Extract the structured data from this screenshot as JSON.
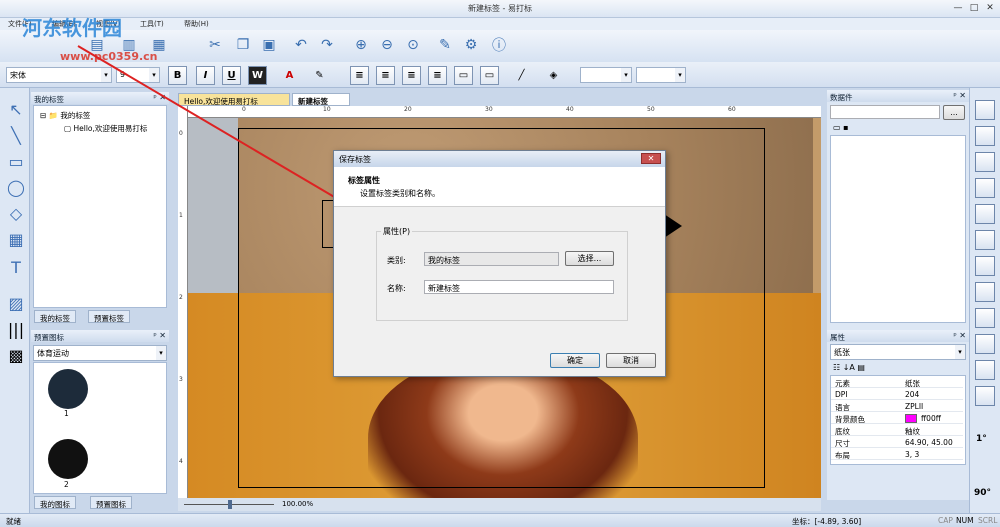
{
  "window": {
    "title": "新建标签 - 易打标",
    "min": "—",
    "max": "□",
    "close": "✕"
  },
  "menu": [
    "文件(F)",
    "编辑(E)",
    "视图(V)",
    "工具(T)",
    "帮助(H)"
  ],
  "font": {
    "family": "宋体",
    "size": "9"
  },
  "format_buttons": [
    "B",
    "I",
    "U",
    "W"
  ],
  "left_panel": {
    "title": "我的标签",
    "tree_root": "我的标签",
    "tree_child": "Hello,欢迎使用易打标",
    "tabs": [
      "我的标签",
      "预置标签"
    ]
  },
  "preset_panel": {
    "title": "预置图标",
    "category": "体育运动",
    "items": [
      "1",
      "2"
    ],
    "tabs": [
      "我的图标",
      "预置图标"
    ]
  },
  "doc_tabs": [
    "Hello,欢迎使用易打标",
    "新建标签"
  ],
  "ruler_h": [
    "0",
    "10",
    "20",
    "30",
    "40",
    "50",
    "60"
  ],
  "ruler_v": [
    "0",
    "1",
    "2",
    "3",
    "4"
  ],
  "zoom": "100.00%",
  "dialog": {
    "title": "保存标签",
    "heading": "标签属性",
    "subheading": "设置标签类别和名称。",
    "group_label": "属性(P)",
    "category_label": "类别:",
    "category_value": "我的标签",
    "choose_button": "选择...",
    "name_label": "名称:",
    "name_value": "新建标签",
    "ok_button": "确定",
    "cancel_button": "取消"
  },
  "data_panel": {
    "title": "数据件",
    "browse": "..."
  },
  "props_panel": {
    "title": "属性",
    "selector": "纸张",
    "rows": [
      {
        "k": "元素",
        "v": "纸张"
      },
      {
        "k": "DPI",
        "v": "204"
      },
      {
        "k": "语言",
        "v": "ZPLII"
      },
      {
        "k": "背景颜色",
        "v": "ff00ff"
      },
      {
        "k": "底纹",
        "v": "釉纹"
      },
      {
        "k": "尺寸",
        "v": "64.90, 45.00"
      },
      {
        "k": "布局",
        "v": "3, 3"
      }
    ],
    "bg_color": "#ff00ff"
  },
  "status": {
    "left": "就绪",
    "coords": "坐标：[-4.89, 3.60]",
    "caps": "CAP",
    "num": "NUM",
    "scrl": "SCRL"
  },
  "watermark": {
    "brand": "河东软件园",
    "url": "www.pc0359.cn"
  },
  "right_rotate": [
    "1°",
    "90°"
  ]
}
